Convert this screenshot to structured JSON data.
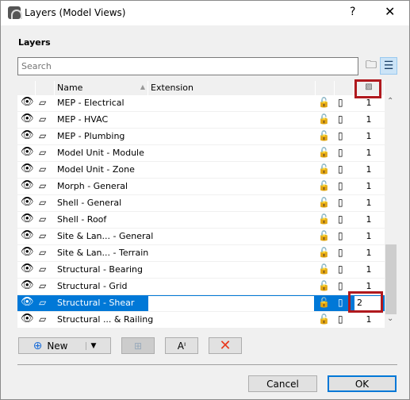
{
  "window": {
    "title": "Layers (Model Views)",
    "help": "?",
    "close": "✕"
  },
  "section_label": "Layers",
  "search": {
    "placeholder": "Search",
    "value": ""
  },
  "columns": {
    "name": "Name",
    "extension": "Extension"
  },
  "rows": [
    {
      "name": "MEP - Electrical",
      "value": "1"
    },
    {
      "name": "MEP - HVAC",
      "value": "1"
    },
    {
      "name": "MEP - Plumbing",
      "value": "1"
    },
    {
      "name": "Model Unit - Module",
      "value": "1"
    },
    {
      "name": "Model Unit - Zone",
      "value": "1"
    },
    {
      "name": "Morph - General",
      "value": "1"
    },
    {
      "name": "Shell - General",
      "value": "1"
    },
    {
      "name": "Shell - Roof",
      "value": "1"
    },
    {
      "name": "Site & Lan... - General",
      "value": "1"
    },
    {
      "name": "Site & Lan... - Terrain",
      "value": "1"
    },
    {
      "name": "Structural - Bearing",
      "value": "1"
    },
    {
      "name": "Structural - Grid",
      "value": "1"
    },
    {
      "name": "Structural - Shear",
      "value": "2",
      "selected": true,
      "editing": true
    },
    {
      "name": "Structural ... & Railing",
      "value": "1"
    }
  ],
  "buttons": {
    "new": "New",
    "cancel": "Cancel",
    "ok": "OK"
  },
  "colors": {
    "selection": "#0078d7",
    "highlight": "#b0191e",
    "delete": "#e8391e"
  }
}
